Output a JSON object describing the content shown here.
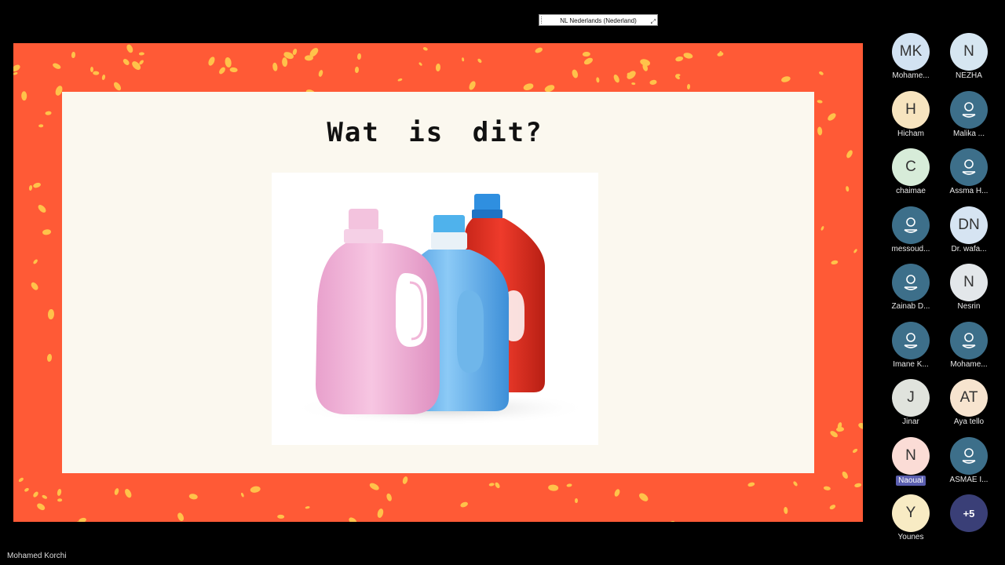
{
  "language_bar": {
    "label": "NL Nederlands (Nederland)"
  },
  "slide": {
    "title": "Wat is dit?"
  },
  "colors": {
    "frame": "#ff5a36",
    "confetti": "#ffc24a",
    "slide_bg": "#fbf8ef"
  },
  "participants": [
    {
      "initials": "MK",
      "name": "Mohame...",
      "color": "#d2e2f2",
      "icon": ""
    },
    {
      "initials": "N",
      "name": "NEZHA",
      "color": "#d6e6f1",
      "icon": ""
    },
    {
      "initials": "H",
      "name": "Hicham",
      "color": "#f7e4bf",
      "icon": ""
    },
    {
      "initials": "",
      "name": "Malika ...",
      "color": "",
      "icon": "person-icon"
    },
    {
      "initials": "C",
      "name": "chaimae",
      "color": "#d7ecd9",
      "icon": ""
    },
    {
      "initials": "",
      "name": "Assma H...",
      "color": "",
      "icon": "person-icon"
    },
    {
      "initials": "",
      "name": "messoud...",
      "color": "",
      "icon": "person-icon"
    },
    {
      "initials": "DN",
      "name": "Dr. wafa...",
      "color": "#d6e4f2",
      "icon": ""
    },
    {
      "initials": "",
      "name": "Zainab D...",
      "color": "",
      "icon": "person-icon"
    },
    {
      "initials": "N",
      "name": "Nesrin",
      "color": "#e3e7ea",
      "icon": ""
    },
    {
      "initials": "",
      "name": "Imane K...",
      "color": "",
      "icon": "person-icon"
    },
    {
      "initials": "",
      "name": "Mohame...",
      "color": "",
      "icon": "person-icon"
    },
    {
      "initials": "J",
      "name": "Jinar",
      "color": "#e0e3dd",
      "icon": ""
    },
    {
      "initials": "AT",
      "name": "Aya tello",
      "color": "#f7e4cf",
      "icon": ""
    },
    {
      "initials": "N",
      "name": "Naoual",
      "color": "#fbdcd6",
      "icon": ""
    },
    {
      "initials": "",
      "name": "ASMAE I...",
      "color": "",
      "icon": "person-icon"
    },
    {
      "initials": "Y",
      "name": "Younes",
      "color": "#f8ebc4",
      "icon": ""
    }
  ],
  "more_participants": "+5",
  "presenter": {
    "name": "Mohamed Korchi"
  }
}
